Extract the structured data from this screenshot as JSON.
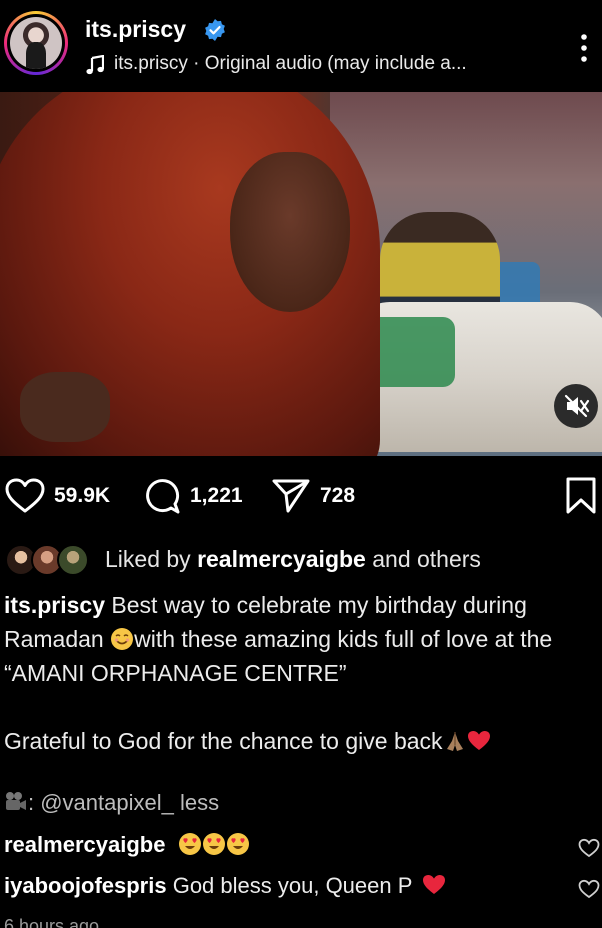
{
  "header": {
    "username": "its.priscy",
    "audio": "its.priscy · Original audio (may include a...",
    "icons": {
      "verified": "verified-badge-icon",
      "music": "music-note-icon",
      "more": "more-vertical-icon"
    },
    "verified_color": "#3897f0"
  },
  "media": {
    "icons": {
      "mute": "muted-speaker-icon"
    }
  },
  "actions": {
    "likes": "59.9K",
    "comments": "1,221",
    "shares": "728",
    "icons": {
      "like": "heart-icon",
      "comment": "comment-icon",
      "share": "share-icon",
      "save": "bookmark-icon"
    }
  },
  "liked_by": {
    "prefix": "Liked by ",
    "user": "realmercyaigbe",
    "suffix": " and others"
  },
  "caption": {
    "user": "its.priscy",
    "text": " Best way to celebrate my birthday during Ramadan ",
    "text_b": "with these amazing kids full of love at the “AMANI ORPHANAGE CENTRE”",
    "line2": "Grateful to God for the chance to give back",
    "credit": ": @vantapixel_ less"
  },
  "comments": [
    {
      "user": "realmercyaigbe",
      "text": ""
    },
    {
      "user": "iyaboojofespris",
      "text": " God bless you, Queen P"
    }
  ],
  "timestamp": "6 hours ago"
}
